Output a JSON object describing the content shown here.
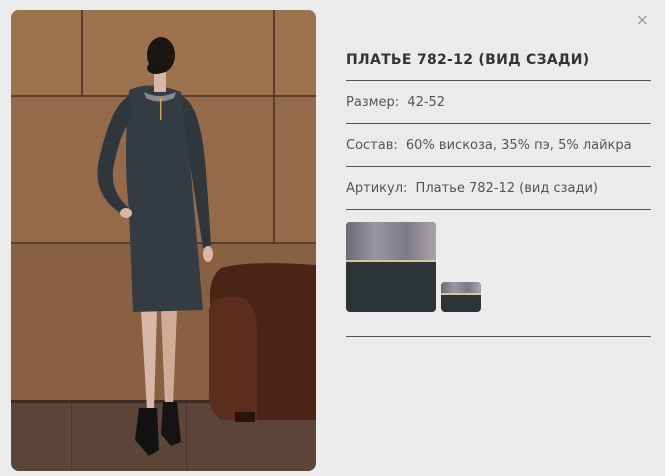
{
  "dialog": {
    "close_symbol": "×",
    "title": "ПЛАТЬЕ 782-12 (ВИД СЗАДИ)",
    "size": {
      "label": "Размер:",
      "value": "42-52"
    },
    "composition": {
      "label": "Состав:",
      "value": "60% вискоза, 35% пэ, 5% лайкра"
    },
    "article": {
      "label": "Артикул:",
      "value": "Платье 782-12 (вид сзади)"
    }
  },
  "icons": {
    "close": "close-icon"
  }
}
